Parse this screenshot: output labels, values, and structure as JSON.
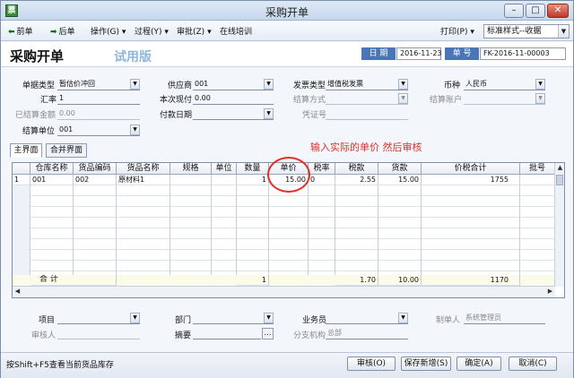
{
  "window": {
    "title": "采购开单",
    "app_icon": "票"
  },
  "toolbar": {
    "prev": "前单",
    "next": "后单",
    "operate": "操作(G)",
    "process": "过程(Y)",
    "approve": "审批(Z)",
    "training": "在线培训",
    "print": "打印(P)",
    "style_value": "标准样式--收据"
  },
  "header": {
    "title": "采购开单",
    "trial": "试用版",
    "date_label": "日 期",
    "date_value": "2016-11-23",
    "no_label": "单 号",
    "no_value": "FK-2016-11-00003"
  },
  "form": {
    "bill_type_label": "单据类型",
    "bill_type_value": "暂估价冲回",
    "supplier_label": "供应商",
    "supplier_value": "001",
    "invoice_type_label": "发票类型",
    "invoice_type_value": "增值税发票",
    "currency_label": "币种",
    "currency_value": "人民币",
    "rate_label": "汇率",
    "rate_value": "1",
    "cash_label": "本次现付",
    "cash_value": "0.00",
    "settle_method_label": "结算方式",
    "settle_account_label": "结算账户",
    "settled_label": "已结算金额",
    "settled_value": "0.00",
    "pay_date_label": "付款日期",
    "voucher_label": "凭证号",
    "settle_unit_label": "结算单位",
    "settle_unit_value": "001"
  },
  "tabs": [
    "主界面",
    "合并界面"
  ],
  "annotation": "输入实际的单价  然后审核",
  "grid": {
    "columns": [
      "仓库名称",
      "货品编码",
      "货品名称",
      "规格",
      "单位",
      "数量",
      "单价",
      "税率",
      "税款",
      "货款",
      "价税合计",
      "批号"
    ],
    "row": {
      "index": "1",
      "warehouse": "001",
      "code": "002",
      "name": "原材料1",
      "spec": "",
      "unit": "",
      "qty": "1",
      "price": "15.00",
      "tax_rate": "0",
      "tax": "2.55",
      "amount": "15.00",
      "total": "1755",
      "batch": ""
    },
    "sum": {
      "label": "合  计",
      "qty": "1",
      "tax": "1.70",
      "amount": "10.00",
      "total": "1170"
    }
  },
  "footer": {
    "item_label": "项目",
    "dept_label": "部门",
    "salesman_label": "业务员",
    "maker_label": "制单人",
    "maker_value": "系统管理员",
    "auditor_label": "审核人",
    "summary_label": "摘要",
    "branch_label": "分支机构",
    "branch_value": "总部"
  },
  "status": {
    "hint": "按Shift+F5查看当前货品库存",
    "audit": "审核(O)",
    "save_new": "保存新增(S)",
    "ok": "确定(A)",
    "cancel": "取消(C)"
  }
}
